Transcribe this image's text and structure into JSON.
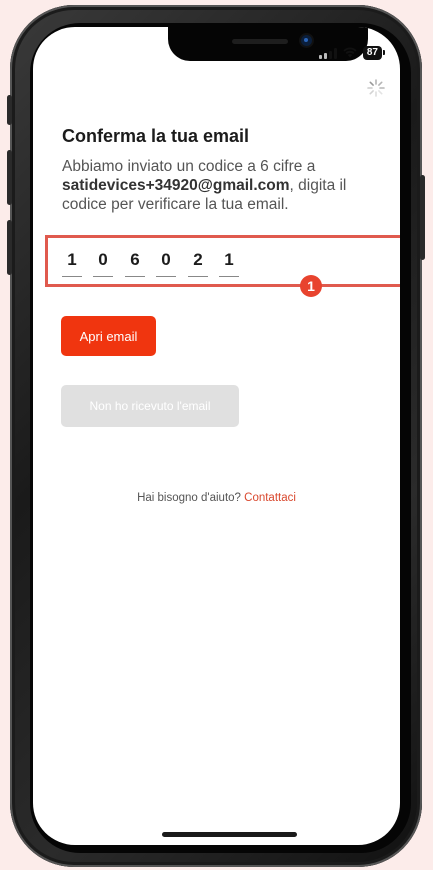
{
  "status_bar": {
    "battery": "87"
  },
  "screen": {
    "title": "Conferma la tua email",
    "description_prefix": "Abbiamo inviato un codice a 6 cifre a",
    "email": "satidevices+34920@gmail.com",
    "description_suffix": ", digita il codice per verificare la tua email.",
    "code_digits": [
      "1",
      "0",
      "6",
      "0",
      "2",
      "1"
    ],
    "annotation_badge": "1",
    "open_email_button": "Apri email",
    "not_received_button": "Non ho ricevuto l'email",
    "help_text": "Hai bisogno d'aiuto?",
    "help_link": "Contattaci"
  },
  "colors": {
    "accent": "#f0350f",
    "highlight_border": "#e05a4e",
    "disabled_button": "#e0e0e0",
    "link": "#d9482e"
  },
  "icons": [
    "signal-icon",
    "wifi-icon",
    "battery-icon",
    "loading-spinner-icon"
  ]
}
